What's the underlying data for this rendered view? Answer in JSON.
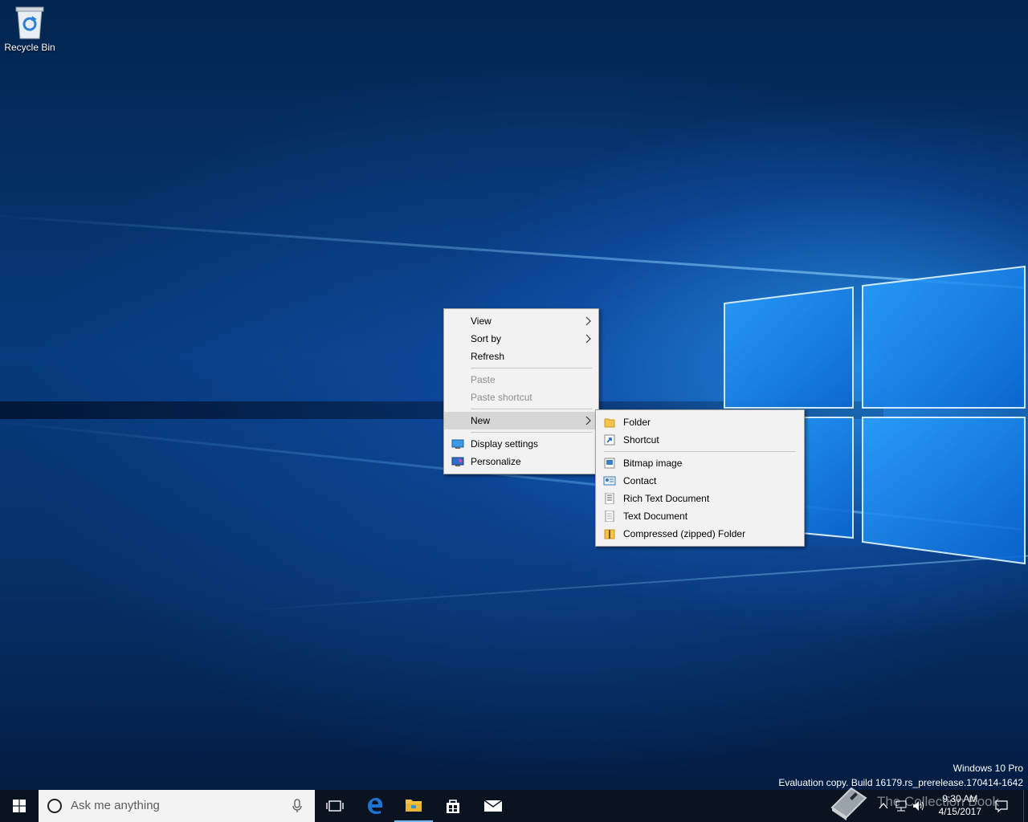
{
  "desktop": {
    "icons": [
      {
        "label": "Recycle Bin",
        "icon": "recycle-bin-icon"
      }
    ]
  },
  "context_menu": {
    "items": [
      {
        "label": "View",
        "has_submenu": true,
        "enabled": true
      },
      {
        "label": "Sort by",
        "has_submenu": true,
        "enabled": true
      },
      {
        "label": "Refresh",
        "enabled": true
      },
      {
        "label": "Paste",
        "enabled": false
      },
      {
        "label": "Paste shortcut",
        "enabled": false
      },
      {
        "label": "New",
        "has_submenu": true,
        "enabled": true,
        "highlighted": true
      },
      {
        "label": "Display settings",
        "icon": "display-settings-icon",
        "enabled": true
      },
      {
        "label": "Personalize",
        "icon": "personalize-icon",
        "enabled": true
      }
    ]
  },
  "new_submenu": {
    "items": [
      {
        "label": "Folder",
        "icon": "folder-icon"
      },
      {
        "label": "Shortcut",
        "icon": "shortcut-icon"
      },
      {
        "label": "Bitmap image",
        "icon": "bitmap-icon"
      },
      {
        "label": "Contact",
        "icon": "contact-icon"
      },
      {
        "label": "Rich Text Document",
        "icon": "rich-text-icon"
      },
      {
        "label": "Text Document",
        "icon": "text-document-icon"
      },
      {
        "label": "Compressed (zipped) Folder",
        "icon": "zip-folder-icon"
      }
    ]
  },
  "watermark": {
    "edition": "Windows 10 Pro",
    "build": "Evaluation copy. Build 16179.rs_prerelease.170414-1642",
    "overlay_text": "The Collection Book"
  },
  "taskbar": {
    "search_placeholder": "Ask me anything",
    "time": "9:30 AM",
    "date": "4/15/2017",
    "pinned": [
      "task-view-icon",
      "edge-icon",
      "file-explorer-icon",
      "store-icon",
      "mail-icon"
    ]
  },
  "colors": {
    "menu_bg": "#f2f2f2",
    "menu_highlight": "#d6d6d6",
    "taskbar_bg": "#0a1420",
    "edge_blue": "#1e74d3",
    "folder_yellow": "#f5c24b"
  }
}
